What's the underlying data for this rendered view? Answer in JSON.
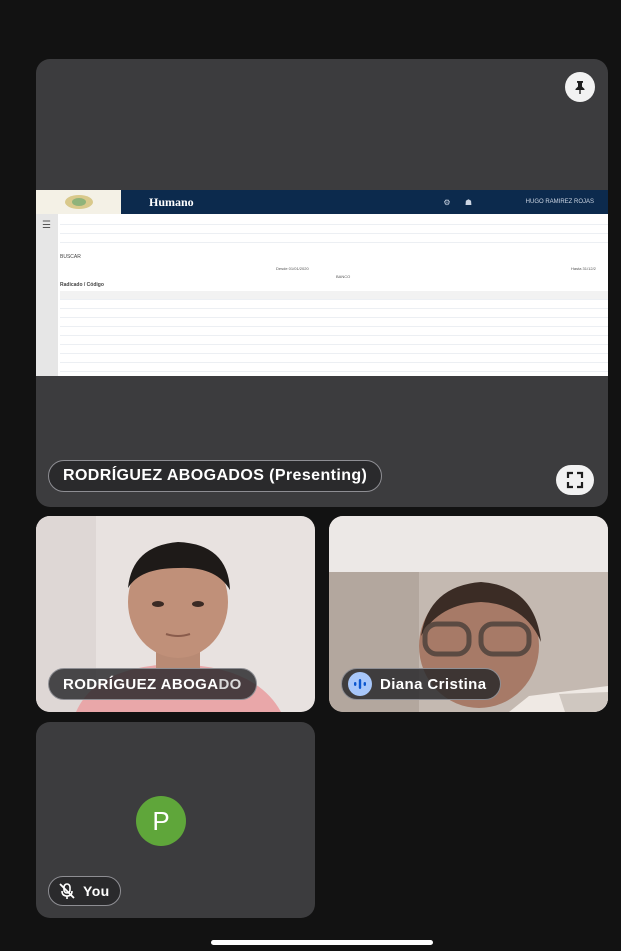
{
  "presenter": {
    "label": "RODRÍGUEZ ABOGADOS (Presenting)",
    "pin_icon": "pin-icon",
    "expand_icon": "fullscreen-icon"
  },
  "shared_screen": {
    "brand": "Humano",
    "user_menu": "HUGO RAMIREZ ROJAS",
    "section_link": "BUSCAR",
    "date_range": "Desde 01/01/2020",
    "date_range_right": "Hasta 31/12/2",
    "table_caption": "BANCO",
    "section_title": "Radicado / Código"
  },
  "participants": [
    {
      "name_visible": "RODRÍGUEZ ABOGA",
      "name_faded": "DO"
    },
    {
      "name": "Diana Cristina",
      "speaking_icon": "audio-speaking-icon"
    }
  ],
  "self_view": {
    "initial": "P",
    "label": "You",
    "mic_icon": "mic-off-icon",
    "avatar_color": "#5fa63a"
  }
}
